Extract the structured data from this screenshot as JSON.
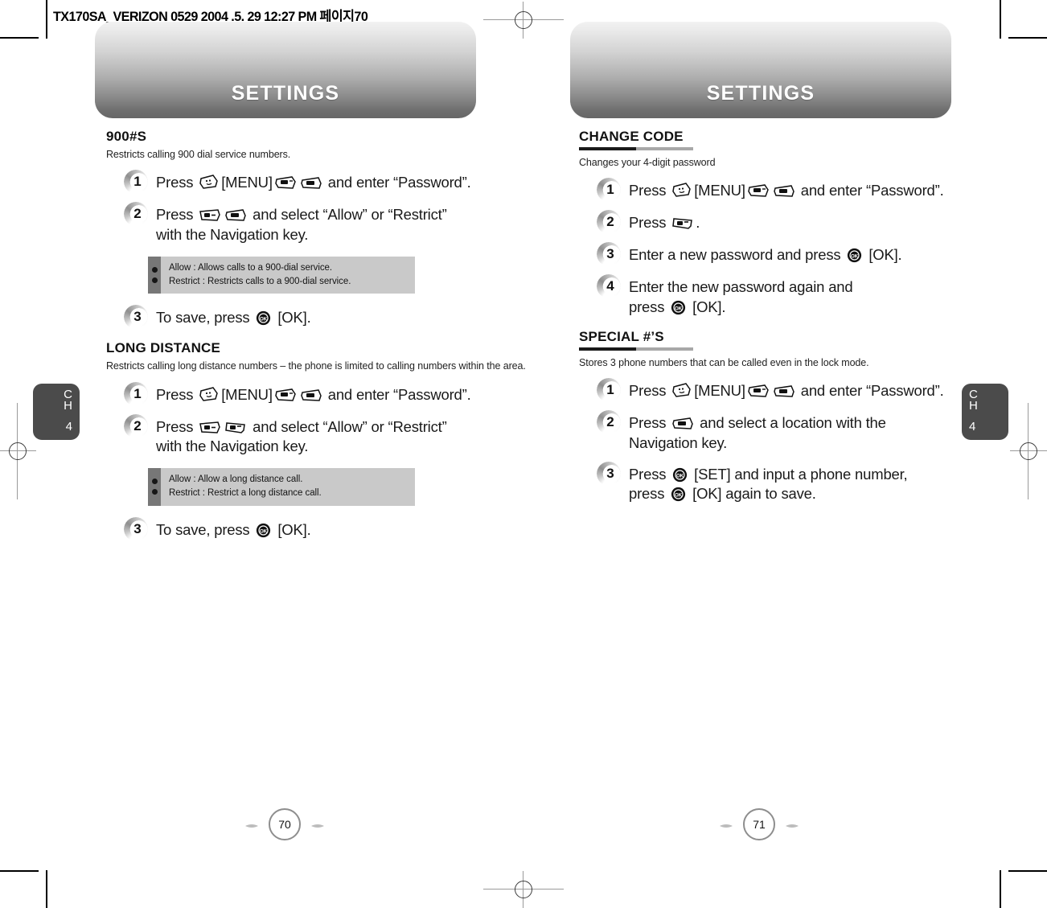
{
  "slug": "TX170SA_VERIZON 0529  2004 .5. 29  12:27 PM  페이지70",
  "banner": {
    "title": "SETTINGS"
  },
  "tabs": {
    "chapter_label": "CH",
    "chapter_number": "4"
  },
  "left_page": {
    "page_number": "70",
    "sections": [
      {
        "title": "900#S",
        "ruled": false,
        "description": "Restricts calling 900 dial service numbers.",
        "steps": [
          {
            "number": "1",
            "lines": [
              "Press [MENU] and enter “Password”."
            ]
          },
          {
            "number": "2",
            "lines": [
              "Press and select “Allow” or “Restrict”",
              "with the Navigation key."
            ]
          },
          {
            "number": "3",
            "lines": [
              "To save, press [OK]."
            ]
          }
        ],
        "note": {
          "after_step": "2",
          "lines": [
            "Allow : Allows calls to a 900-dial service.",
            "Restrict : Restricts calls to a 900-dial service."
          ]
        }
      },
      {
        "title": "LONG DISTANCE",
        "ruled": false,
        "description": "Restricts calling long distance numbers – the phone is limited to calling numbers within the area.",
        "steps": [
          {
            "number": "1",
            "lines": [
              "Press [MENU] and enter “Password”."
            ]
          },
          {
            "number": "2",
            "lines": [
              "Press and select “Allow” or “Restrict”",
              "with the Navigation key."
            ]
          },
          {
            "number": "3",
            "lines": [
              "To save, press [OK]."
            ]
          }
        ],
        "note": {
          "after_step": "2",
          "lines": [
            "Allow : Allow a long distance call.",
            "Restrict : Restrict a long distance call."
          ]
        }
      }
    ]
  },
  "right_page": {
    "page_number": "71",
    "sections": [
      {
        "title": "CHANGE CODE",
        "ruled": true,
        "description": "Changes your 4-digit password",
        "steps": [
          {
            "number": "1",
            "lines": [
              "Press [MENU] and enter “Password”."
            ]
          },
          {
            "number": "2",
            "lines": [
              "Press ."
            ]
          },
          {
            "number": "3",
            "lines": [
              "Enter a new password and press [OK]."
            ]
          },
          {
            "number": "4",
            "lines": [
              "Enter the new password again and",
              "press [OK]."
            ]
          }
        ],
        "note": null
      },
      {
        "title": "SPECIAL #’S",
        "ruled": true,
        "description": "Stores 3 phone numbers that can be called even in the lock mode.",
        "steps": [
          {
            "number": "1",
            "lines": [
              "Press [MENU] and enter “Password”."
            ]
          },
          {
            "number": "2",
            "lines": [
              "Press and select a location with the",
              "Navigation key."
            ]
          },
          {
            "number": "3",
            "lines": [
              "Press [SET] and input a phone number,",
              "press [OK] again to save."
            ]
          }
        ],
        "note": null
      }
    ]
  },
  "icons": {
    "menu_key": "menu-key-icon",
    "nav_key": "navigation-key-icon",
    "soft_key": "soft-key-icon",
    "ok_key": "ok-key-icon"
  },
  "colors": {
    "banner_top": "#f2f2f2",
    "banner_bottom": "#666666",
    "tab_bg": "#4b4b4b",
    "note_bg": "#c9c9c9",
    "note_strip": "#777777",
    "rule_dark": "#1a1a1a",
    "rule_light": "#a8a8a8"
  }
}
